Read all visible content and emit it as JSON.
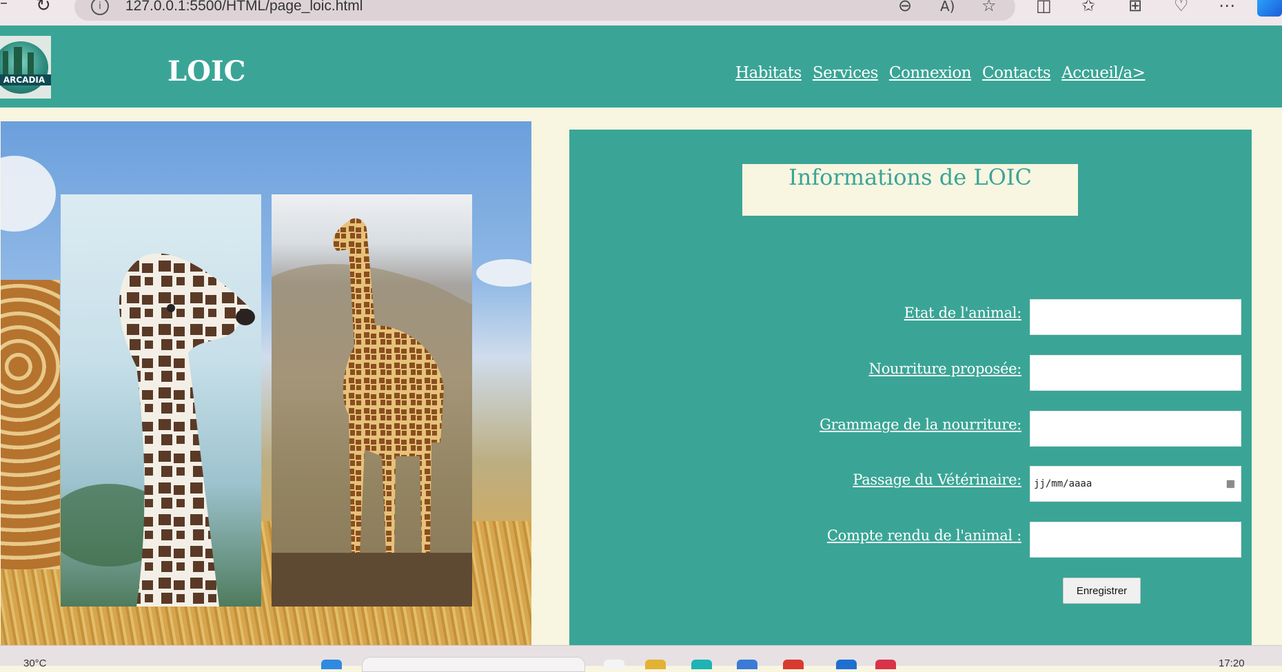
{
  "browser": {
    "url": "127.0.0.1:5500/HTML/page_loic.html",
    "icons": [
      "back-icon",
      "reload-icon",
      "info-icon",
      "zoom-out-icon",
      "read-aloud-icon",
      "favorite-star-icon",
      "split-screen-icon",
      "favorites-icon",
      "collections-icon",
      "browser-essentials-icon",
      "more-icon",
      "copilot-icon"
    ]
  },
  "header": {
    "logo_text": "ARCADIA",
    "title": "LOIC",
    "nav": [
      "Habitats",
      "Services",
      "Connexion",
      "Contacts",
      "Accueil/a>"
    ]
  },
  "form": {
    "heading": "Informations de LOIC",
    "fields": [
      {
        "label": "Etat de l'animal:",
        "value": ""
      },
      {
        "label": "Nourriture proposée:",
        "value": ""
      },
      {
        "label": "Grammage de la nourriture:",
        "value": ""
      },
      {
        "label": "Passage du Vétérinaire:",
        "placeholder": "jj/mm/aaaa"
      },
      {
        "label": "Compte rendu de l'animal :",
        "value": ""
      }
    ],
    "submit_label": "Enregistrer"
  },
  "taskbar": {
    "weather": "30°C",
    "clock": "17:20"
  },
  "colors": {
    "teal": "#3aa596",
    "cream": "#f8f5e0"
  }
}
